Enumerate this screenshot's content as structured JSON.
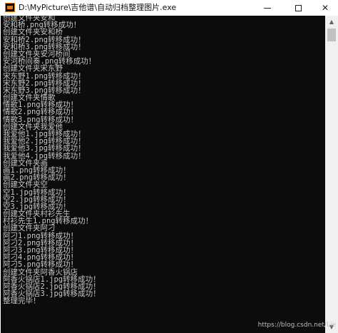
{
  "window": {
    "title": "D:\\MyPicture\\吉他谱\\自动归档整理图片.exe",
    "minimize_glyph": "",
    "maximize_glyph": "",
    "close_glyph": "✕"
  },
  "console": {
    "lines": [
      "创建文件夹安和",
      "安和桥.png转移成功！",
      "创建文件夹安和桥",
      "安和桥2.png转移成功！",
      "安和桥3.png转移成功！",
      "创建文件夹安河桥间",
      "安河桥间奏.png转移成功！",
      "创建文件夹宋东野",
      "宋东野1.png转移成功！",
      "宋东野2.png转移成功！",
      "宋东野3.png转移成功！",
      "创建文件夹情歌",
      "情歌1.png转移成功！",
      "情歌2.png转移成功！",
      "情歌3.png转移成功！",
      "创建文件夹我爱他",
      "我爱他1.jpg转移成功！",
      "我爱他2.jpg转移成功！",
      "我爱他3.jpg转移成功！",
      "我爱他4.jpg转移成功！",
      "创建文件夹画",
      "画1.png转移成功！",
      "画2.png转移成功！",
      "创建文件夹空",
      "空1.jpg转移成功！",
      "空2.jpg转移成功！",
      "空3.jpg转移成功！",
      "创建文件夹村衫先生",
      "村衫先生1.png转移成功！",
      "创建文件夹阿刁",
      "阿刁1.png转移成功！",
      "阿刁2.png转移成功！",
      "阿刁3.png转移成功！",
      "阿刁4.png转移成功！",
      "阿刁5.png转移成功！",
      "创建文件夹阿香火锅店",
      "阿香火锅店1.jpg转移成功！",
      "阿香火锅店2.jpg转移成功！",
      "阿香火锅店3.jpg转移成功！",
      "整理完毕！"
    ]
  },
  "scrollbar": {
    "up_glyph": "▲",
    "down_glyph": "▼"
  },
  "watermark": "https://blog.csdn.net/Lie"
}
